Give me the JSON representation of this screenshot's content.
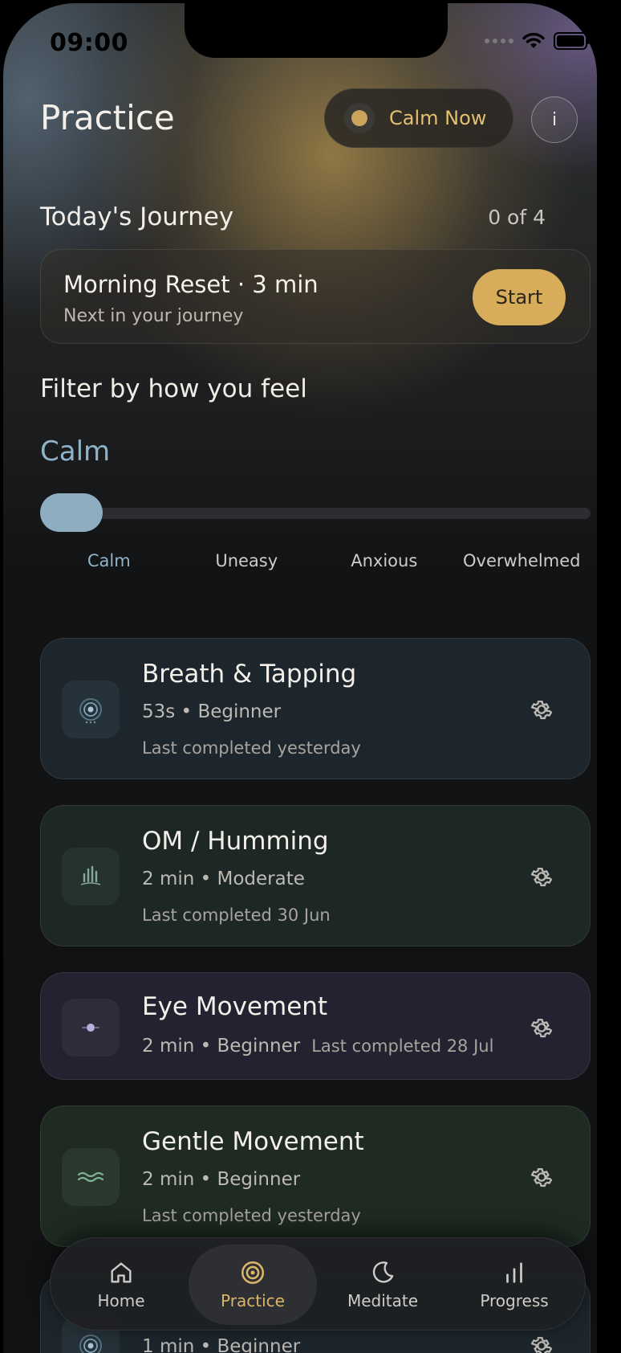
{
  "status": {
    "time": "09:00"
  },
  "header": {
    "title": "Practice",
    "calm_now_label": "Calm Now",
    "info_label": "i"
  },
  "journey": {
    "title": "Today's Journey",
    "progress": "0 of 4",
    "next_title": "Morning Reset · 3 min",
    "next_subtitle": "Next in your journey",
    "start_label": "Start"
  },
  "filter": {
    "title": "Filter by how you feel",
    "current": "Calm",
    "slider_fraction": 0,
    "options": [
      "Calm",
      "Uneasy",
      "Anxious",
      "Overwhelmed"
    ],
    "selected_index": 0
  },
  "practices": [
    {
      "title": "Breath & Tapping",
      "meta": "53s • Beginner",
      "last": "Last completed yesterday",
      "icon": "breath-target-icon"
    },
    {
      "title": "OM / Humming",
      "meta": "2 min • Moderate",
      "last": "Last completed 30 Jun",
      "icon": "sound-wave-icon"
    },
    {
      "title": "Eye Movement",
      "meta": "2 min • Beginner",
      "last": "Last completed 28 Jul",
      "icon": "eye-dot-icon"
    },
    {
      "title": "Gentle Movement",
      "meta": "2 min • Beginner",
      "last": "Last completed yesterday",
      "icon": "wave-icon"
    },
    {
      "meta": "1 min • Beginner",
      "icon": "breath-target-icon"
    }
  ],
  "nav": {
    "items": [
      {
        "label": "Home",
        "icon": "home-icon"
      },
      {
        "label": "Practice",
        "icon": "target-icon"
      },
      {
        "label": "Meditate",
        "icon": "moon-icon"
      },
      {
        "label": "Progress",
        "icon": "bar-chart-icon"
      }
    ],
    "active_index": 1
  },
  "colors": {
    "accent_gold": "#d7ad5c",
    "calm_blue": "#8fb3c9",
    "background": "#111214"
  }
}
